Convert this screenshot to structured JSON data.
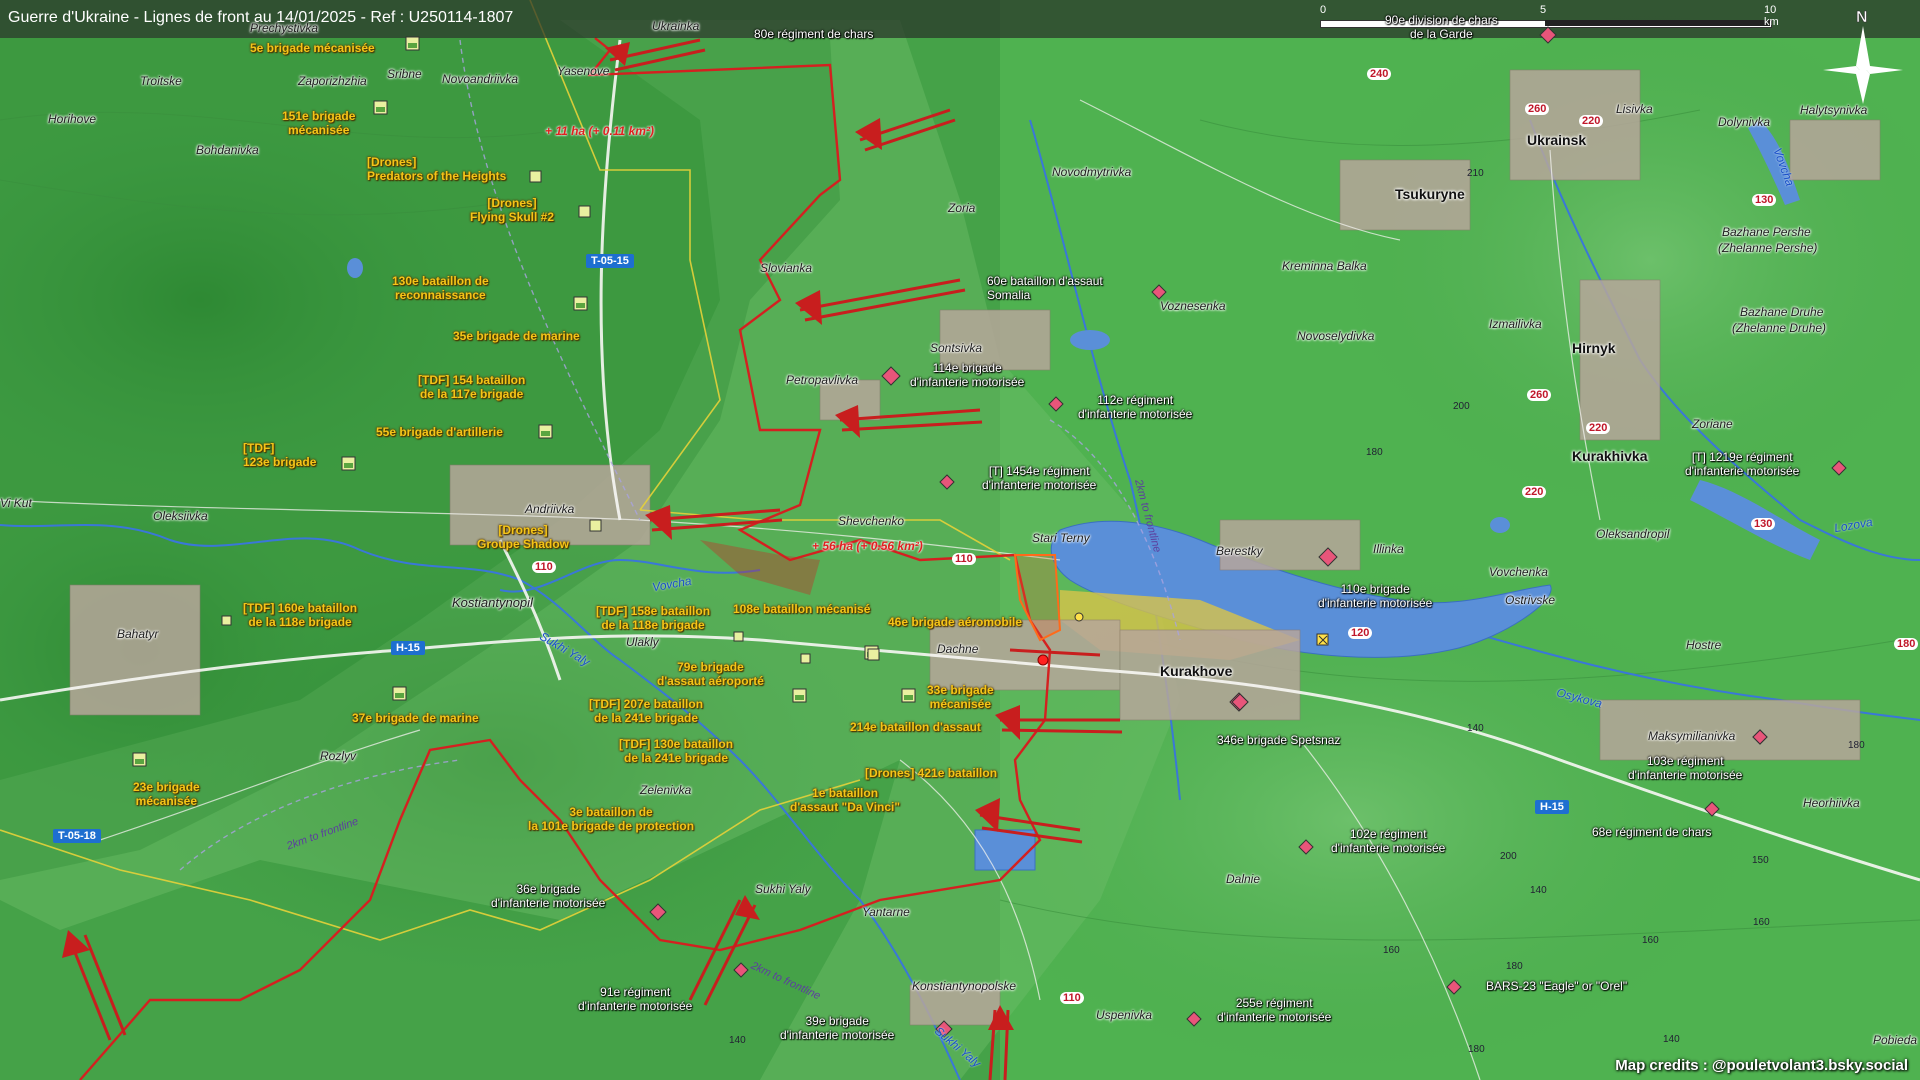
{
  "title": "Guerre d'Ukraine - Lignes de front au 14/01/2025 - Ref : U250114-1807",
  "credits": "Map credits : @pouletvolant3.bsky.social",
  "scale": {
    "ticks": [
      "0",
      "5",
      "10 km"
    ]
  },
  "north_label": "N",
  "colors": {
    "terrain": "#3f9a44",
    "frontline": "#d42020",
    "ukraine_units": "#f5c518",
    "russia_units": "#e8557a",
    "water": "#5a8fd8",
    "roads_badge": "#1e6fd0"
  },
  "towns": [
    "Ukrainka",
    "Prechystivka",
    "Sribne",
    "Novoandriivka",
    "Yasenove",
    "Troitske",
    "Zaporizhzhia",
    "Horihove",
    "Bohdanivka",
    "Zoria",
    "Novodmytrivka",
    "Slovianka",
    "Sontsivka",
    "Petropavlivka",
    "Oleksiivka",
    "Andriivka",
    "Shevchenko",
    "Stari Terny",
    "Kostiantynopil",
    "Bahatyr",
    "Ulakly",
    "Dachne",
    "Zelenivka",
    "Rozlyv",
    "Sukhi Yaly",
    "Yantarne",
    "Konstiantynopolske",
    "Uspenivka",
    "Voznesenka",
    "Kreminna Balka",
    "Novoselydivka",
    "Izmailivka",
    "Berestky",
    "Illinka",
    "Vovchenka",
    "Ostrivske",
    "Hostre",
    "Maksymilianivka",
    "Heorhiivka",
    "Dalnie",
    "Lisivka",
    "Dolynivka",
    "Halytsynivka",
    "Bazhane Pershe",
    "(Zhelanne Pershe)",
    "Bazhane Druhe",
    "(Zhelanne Druhe)",
    "Zoriane",
    "Oleksandropil",
    "Pobieda",
    "Vi Kut"
  ],
  "cities": [
    "Ukrainsk",
    "Tsukuryne",
    "Hirnyk",
    "Kurakhivka",
    "Kurakhove"
  ],
  "ukraine_units": [
    "5e brigade mécanisée",
    "151e brigade\nmécanisée",
    "[Drones]\nPredators of the Heights",
    "[Drones]\nFlying Skull #2",
    "130e bataillon de\nreconnaissance",
    "35e brigade de marine",
    "[TDF] 154 bataillon\nde la 117e brigade",
    "55e brigade d'artillerie",
    "[TDF]\n123e brigade",
    "[Drones]\nGroupe Shadow",
    "[TDF] 160e bataillon\nde la 118e brigade",
    "[TDF] 158e bataillon\nde la 118e brigade",
    "108e bataillon mécanisé",
    "46e brigade aéromobile",
    "79e brigade\nd'assaut aéroporté",
    "33e brigade\nmécanisée",
    "[TDF] 207e bataillon\nde la 241e brigade",
    "214e bataillon d'assaut",
    "[TDF] 130e bataillon\nde la 241e brigade",
    "[Drones] 421e bataillon",
    "1e bataillon\nd'assaut \"Da Vinci\"",
    "3e bataillon de\nla 101e brigade de protection",
    "37e brigade de marine",
    "23e brigade\nmécanisée"
  ],
  "russia_units": [
    "80e régiment de chars",
    "90e division de chars\nde la Garde",
    "60e bataillon d'assaut\nSomalia",
    "114e brigade\nd'infanterie motorisée",
    "112e régiment\nd'infanterie motorisée",
    "[T] 1454e régiment\nd'infanterie motorisée",
    "110e brigade\nd'infanterie motorisée",
    "[T] 1219e régiment\nd'infanterie motorisée",
    "346e brigade Spetsnaz",
    "103e régiment\nd'infanterie motorisée",
    "68e régiment de chars",
    "102e régiment\nd'infanterie motorisée",
    "36e brigade\nd'infanterie motorisée",
    "91e régiment\nd'infanterie motorisée",
    "39e brigade\nd'infanterie motorisée",
    "255e régiment\nd'infanterie motorisée",
    "BARS-23 \"Eagle\" or \"Orel\""
  ],
  "gains": [
    "+ 11 ha (+ 0.11 km²)",
    "+ 56 ha (+ 0.56 km²)"
  ],
  "road_badges": [
    "T-05-15",
    "H-15",
    "T-05-18",
    "H-15"
  ],
  "road_numbers": [
    "110",
    "110",
    "110",
    "120",
    "130",
    "130",
    "240",
    "260",
    "260",
    "220",
    "220",
    "220",
    "180"
  ],
  "elevations": [
    "210",
    "200",
    "180",
    "180",
    "160",
    "160",
    "160",
    "140",
    "140",
    "140",
    "180",
    "200",
    "150",
    "180",
    "140"
  ],
  "water_labels": [
    "Vovcha",
    "Sukhi Yaly",
    "Osykova",
    "Lozova",
    "Vovcha",
    "Sukhi Yaly"
  ],
  "distance_labels": [
    "2km to frontline",
    "2km to frontline",
    "2km to frontline"
  ]
}
